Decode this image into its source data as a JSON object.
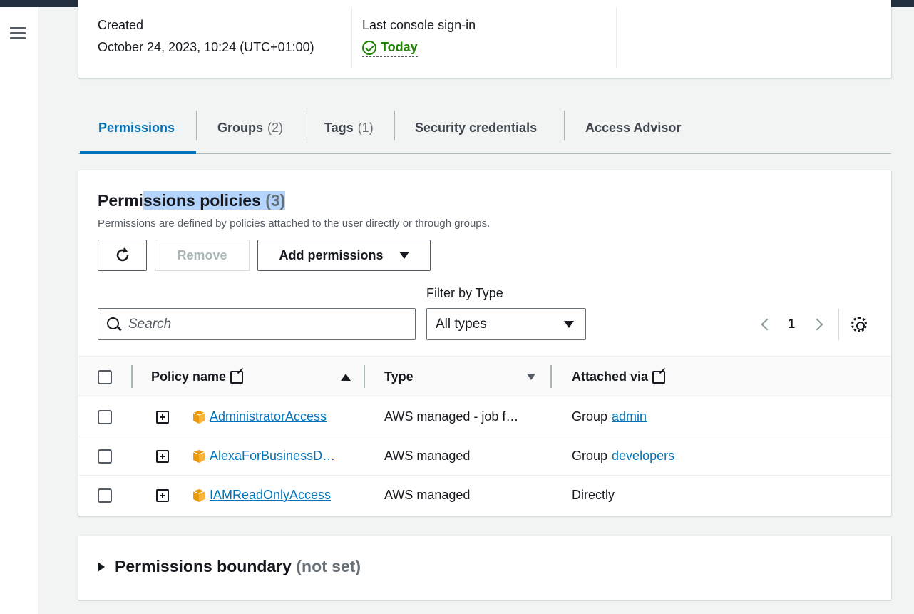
{
  "summary": {
    "created_label": "Created",
    "created_value": "October 24, 2023, 10:24 (UTC+01:00)",
    "signin_label": "Last console sign-in",
    "signin_value": "Today"
  },
  "tabs": [
    {
      "label": "Permissions",
      "count": ""
    },
    {
      "label": "Groups",
      "count": "(2)"
    },
    {
      "label": "Tags",
      "count": "(1)"
    },
    {
      "label": "Security credentials",
      "count": ""
    },
    {
      "label": "Access Advisor",
      "count": ""
    }
  ],
  "permissions": {
    "title_pre": "Permi",
    "title_selected": "ssions policies (3)",
    "title_selected_main": "ssions policies",
    "title_count": "(3)",
    "description": "Permissions are defined by policies attached to the user directly or through groups.",
    "remove_label": "Remove",
    "add_label": "Add permissions",
    "filter_label": "Filter by Type",
    "search_placeholder": "Search",
    "type_selected": "All types",
    "page": "1",
    "columns": {
      "policy_name": "Policy name",
      "type": "Type",
      "attached_via": "Attached via"
    },
    "rows": [
      {
        "name": "AdministratorAccess",
        "type": "AWS managed - job f…",
        "via_prefix": "Group",
        "via_link": "admin"
      },
      {
        "name": "AlexaForBusinessD…",
        "type": "AWS managed",
        "via_prefix": "Group",
        "via_link": "developers"
      },
      {
        "name": "IAMReadOnlyAccess",
        "type": "AWS managed",
        "via_prefix": "Directly",
        "via_link": ""
      }
    ]
  },
  "boundary": {
    "title": "Permissions boundary",
    "note": "(not set)"
  },
  "icons": {
    "menu": "hamburger-menu-icon",
    "status": "check-circle-icon",
    "refresh": "refresh-icon",
    "search": "search-icon",
    "settings": "gear-icon",
    "external": "external-link-icon",
    "policy": "aws-cube-icon"
  },
  "colors": {
    "accent": "#0073bb",
    "success": "#1d8102",
    "policy_icon": "#ec9a0e",
    "header_bg": "#232f3e"
  }
}
